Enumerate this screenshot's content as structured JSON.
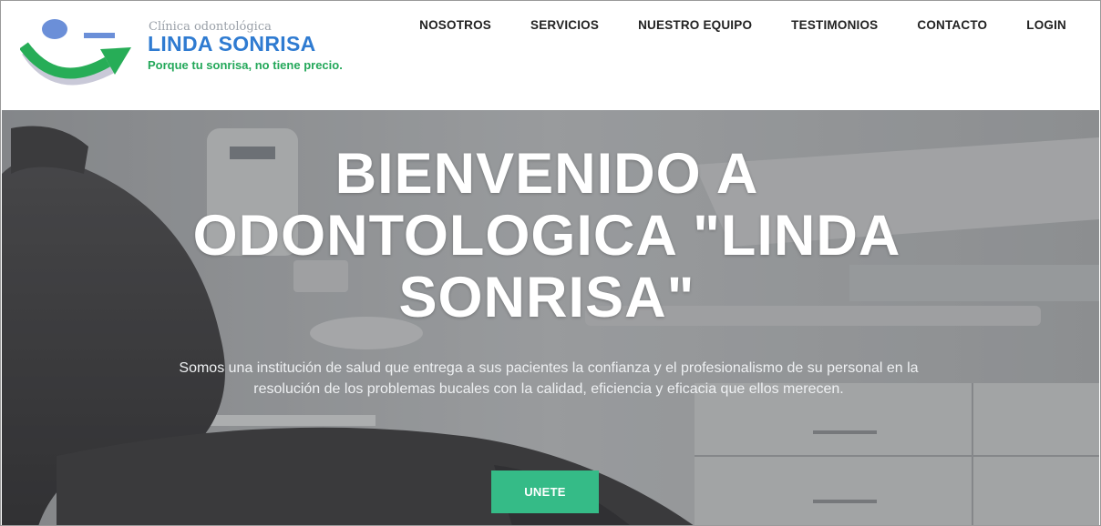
{
  "brand": {
    "top_line": "Clínica odontológica",
    "name": "LINDA SONRISA",
    "slogan": "Porque tu sonrisa, no tiene precio."
  },
  "nav": {
    "items": [
      "NOSOTROS",
      "SERVICIOS",
      "NUESTRO EQUIPO",
      "TESTIMONIOS",
      "CONTACTO",
      "LOGIN"
    ]
  },
  "hero": {
    "title": "BIENVENIDO A ODONTOLOGICA \"LINDA SONRISA\"",
    "description": "Somos una institución de salud que entrega a sus pacientes la confianza y el profesionalismo de su personal en la resolución de los problemas bucales con la calidad, eficiencia y eficacia que ellos merecen.",
    "button_label": "UNETE"
  },
  "colors": {
    "brand_blue": "#2f7bd1",
    "brand_green": "#24a85a",
    "cta_green": "#35bb87"
  }
}
